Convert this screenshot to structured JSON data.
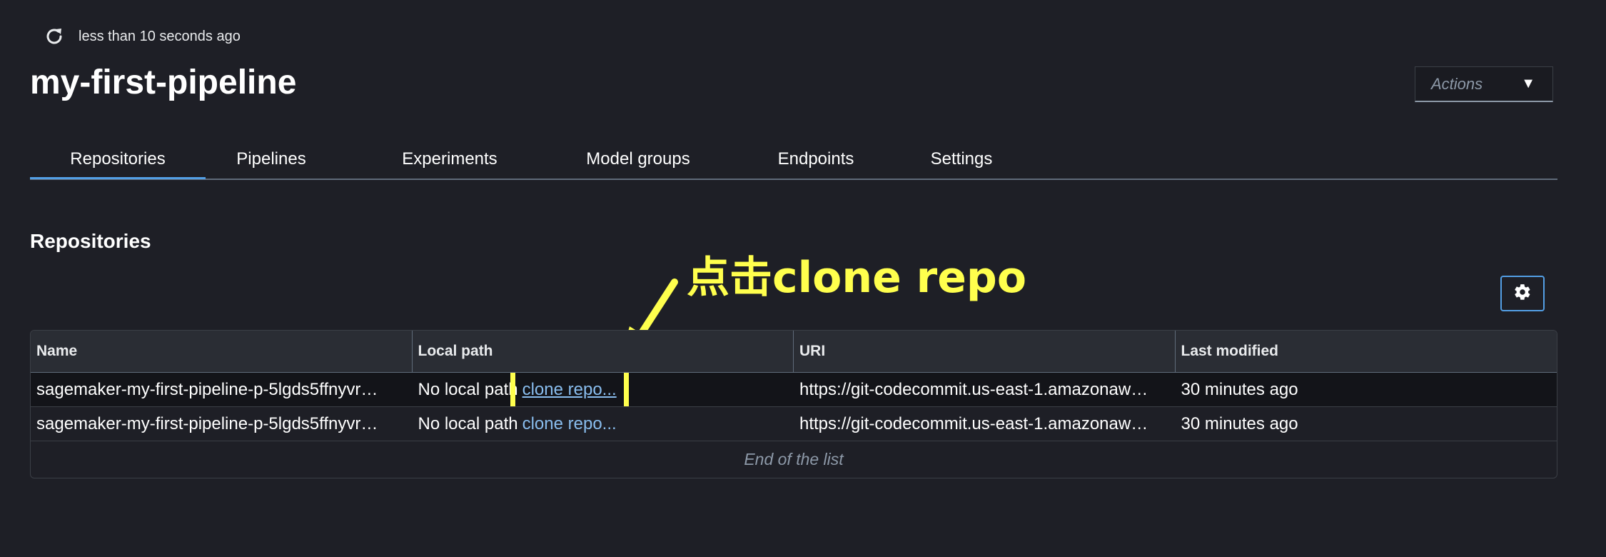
{
  "header": {
    "refresh_text": "less than 10 seconds ago",
    "title": "my-first-pipeline",
    "actions_label": "Actions"
  },
  "tabs": [
    {
      "label": "Repositories",
      "active": true
    },
    {
      "label": "Pipelines"
    },
    {
      "label": "Experiments"
    },
    {
      "label": "Model groups"
    },
    {
      "label": "Endpoints"
    },
    {
      "label": "Settings"
    }
  ],
  "section_title": "Repositories",
  "annotation": {
    "text": "点击clone repo",
    "color": "#ffff4d"
  },
  "table": {
    "columns": [
      "Name",
      "Local path",
      "URI",
      "Last modified"
    ],
    "rows": [
      {
        "name": "sagemaker-my-first-pipeline-p-5lgds5ffnyvr…",
        "local_path": "No local path",
        "clone_link": "clone repo...",
        "uri": "https://git-codecommit.us-east-1.amazonaw…",
        "last_modified": "30 minutes ago"
      },
      {
        "name": "sagemaker-my-first-pipeline-p-5lgds5ffnyvr…",
        "local_path": "No local path",
        "clone_link": "clone repo...",
        "uri": "https://git-codecommit.us-east-1.amazonaw…",
        "last_modified": "30 minutes ago"
      }
    ],
    "footer": "End of the list"
  },
  "icons": {
    "refresh": "refresh-icon",
    "caret": "caret-down-icon",
    "settings": "gear-icon"
  },
  "colors": {
    "background": "#1e1f26",
    "link": "#89bdee",
    "active_tab": "#539fe5",
    "annotation": "#ffff4d"
  }
}
